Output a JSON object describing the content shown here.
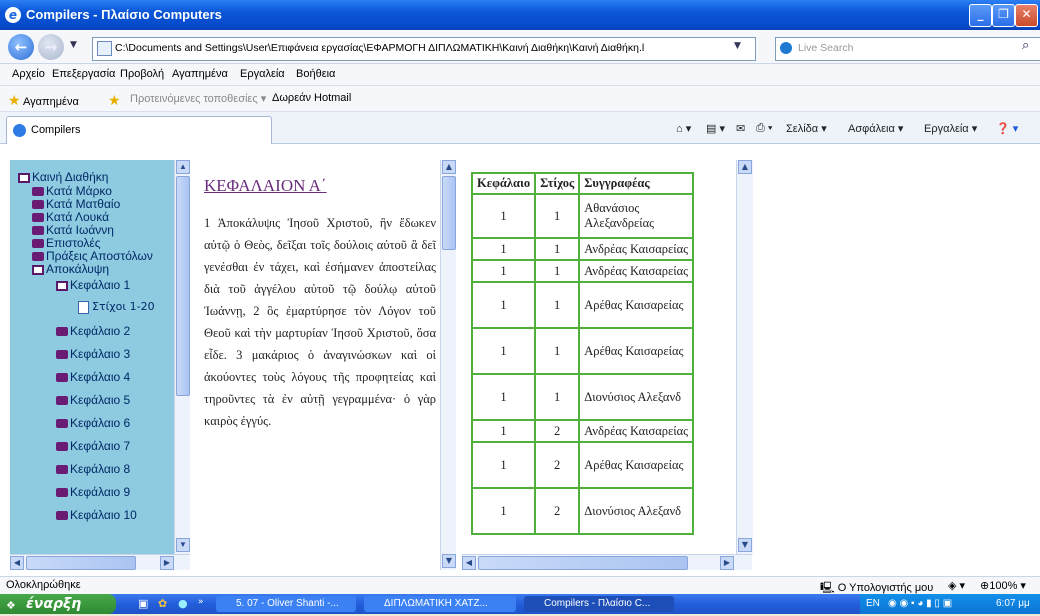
{
  "window": {
    "title": "Compilers - Πλαίσιο Computers"
  },
  "address": {
    "url": "C:\\Documents and Settings\\User\\Επιφάνεια εργασίας\\ΕΦΑΡΜΟΓΗ ΔΙΠΛΩΜΑΤΙΚΗ\\Καινή Διαθήκη\\Καινή Διαθήκη.l",
    "search_placeholder": "Live Search"
  },
  "menu": [
    "Αρχείο",
    "Επεξεργασία",
    "Προβολή",
    "Αγαπημένα",
    "Εργαλεία",
    "Βοήθεια"
  ],
  "favorites": {
    "label": "Αγαπημένα",
    "suggested": "Προτεινόμενες τοποθεσίες",
    "hotmail": "Δωρεάν Hotmail"
  },
  "tab": {
    "label": "Compilers"
  },
  "commandbar": {
    "page": "Σελίδα",
    "safety": "Ασφάλεια",
    "tools": "Εργαλεία"
  },
  "tree": {
    "root": "Καινή Διαθήκη",
    "books": [
      "Κατά Μάρκο",
      "Κατά Ματθαίο",
      "Κατά Λουκά",
      "Κατά Ιωάννη",
      "Επιστολές",
      "Πράξεις Αποστόλων"
    ],
    "revelation": "Αποκάλυψη",
    "chapter1": "Κεφάλαιο 1",
    "verses_item": "Στίχοι 1-20",
    "chapters": [
      "Κεφάλαιο 2",
      "Κεφάλαιο 3",
      "Κεφάλαιο 4",
      "Κεφάλαιο 5",
      "Κεφάλαιο 6",
      "Κεφάλαιο 7",
      "Κεφάλαιο 8",
      "Κεφάλαιο 9",
      "Κεφάλαιο 10"
    ]
  },
  "text": {
    "chapter_title": "ΚΕΦΑΛΑΙΟΝ Α΄",
    "verses": "1 Ἀποκάλυψις Ἰησοῦ Χριστοῦ, ἣν ἔδωκεν αὐτῷ ὁ Θεὸς, δεῖξαι τοῖς δούλοις αὐτοῦ ἃ δεῖ γενέσθαι ἐν τάχει, καὶ ἐσήμανεν ἀποστείλας διὰ τοῦ ἀγγέλου αὐτοῦ τῷ δούλῳ αὐτοῦ Ἰωάννῃ, 2 ὃς ἐμαρτύρησε τὸν Λόγον τοῦ Θεοῦ καὶ τὴν μαρτυρίαν Ἰησοῦ Χριστοῦ, ὅσα εἶδε. 3 μακάριος ὁ ἀναγινώσκων καὶ οἱ ἀκούοντες τοὺς λόγους τῆς προφητείας καὶ τηροῦντες τὰ ἐν αὐτῇ γεγραμμένα· ὁ γὰρ καιρὸς ἐγγύς."
  },
  "table": {
    "headers": [
      "Κεφάλαιο",
      "Στίχος",
      "Συγγραφέας"
    ],
    "rows": [
      [
        "1",
        "1",
        "Αθανάσιος Αλεξανδρείας"
      ],
      [
        "1",
        "1",
        "Ανδρέας Καισαρείας"
      ],
      [
        "1",
        "1",
        "Ανδρέας Καισαρείας"
      ],
      [
        "1",
        "1",
        "Αρέθας Καισαρείας"
      ],
      [
        "1",
        "1",
        "Αρέθας Καισαρείας"
      ],
      [
        "1",
        "1",
        "Διονύσιος Αλεξανδ"
      ],
      [
        "1",
        "2",
        "Ανδρέας Καισαρείας"
      ],
      [
        "1",
        "2",
        "Αρέθας Καισαρείας"
      ],
      [
        "1",
        "2",
        "Διονύσιος Αλεξανδ"
      ]
    ]
  },
  "status": {
    "left": "Ολοκληρώθηκε",
    "zone": "Ο Υπολογιστής μου",
    "zoom": "100%"
  },
  "taskbar": {
    "start": "έναρξη",
    "tasks": [
      "5. 07 - Oliver Shanti -...",
      "ΔΙΠΛΩΜΑΤΙΚΗ ΧΑΤΖ...",
      "Compilers - Πλαίσιο C..."
    ],
    "lang": "EN",
    "time": "6:07 μμ"
  },
  "colors": {
    "tree_bg": "#8ecae0",
    "table_border": "#4fb03b",
    "titlebar": "#0a56d8"
  }
}
